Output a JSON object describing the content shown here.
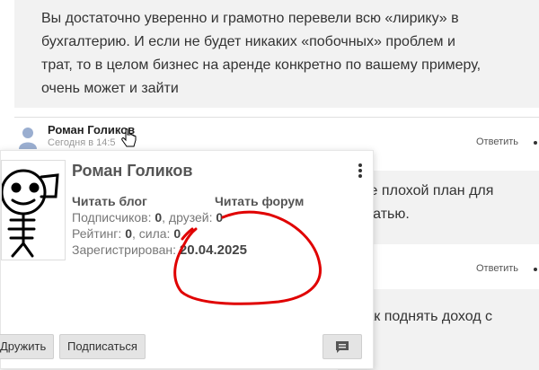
{
  "comment_prev": {
    "text": "Вы достаточно уверенно и грамотно перевели всю «лирику» в\nбухгалтерию. И если не будет никаких «побочных» проблем и\nтрат, то в целом бизнес на аренде конкретно по вашему примеру,\nочень может и зайти"
  },
  "comment": {
    "author": "Роман Голиков",
    "time": "Сегодня в 14:5",
    "reply": "Ответить"
  },
  "bg_comments": [
    {
      "text": "Не плохой план для\nстатью."
    },
    {
      "reply": "Ответить"
    },
    {
      "text": "как поднять доход с"
    }
  ],
  "popup": {
    "name": "Роман Голиков",
    "read_blog": "Читать блог",
    "read_forum": "Читать форум",
    "subscribers_label": "Подписчиков:",
    "subscribers": "0",
    "friends_label": ", друзей:",
    "friends": "0",
    "rating_label": "Рейтинг:",
    "rating": "0",
    "power_label": ", сила:",
    "power": "0",
    "registered_label": "Зарегистрирован:",
    "registered_date": "20.04.2025",
    "friend_button": "Дружить",
    "subscribe_button": "Подписаться"
  },
  "colors": {
    "annotation": "#e00000",
    "avatar_small": "#9aaed0"
  },
  "icons": [
    "user-avatar-icon",
    "hand-cursor-icon",
    "kebab-menu-icon",
    "message-icon"
  ]
}
